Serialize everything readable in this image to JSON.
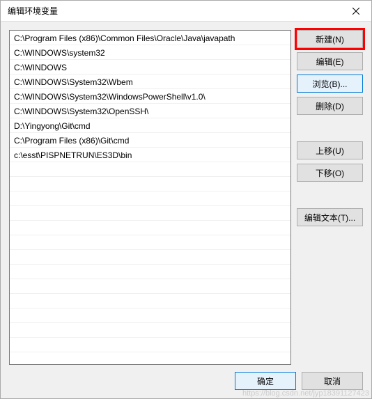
{
  "titlebar": {
    "title": "编辑环境变量"
  },
  "list": {
    "items": [
      "C:\\Program Files (x86)\\Common Files\\Oracle\\Java\\javapath",
      "C:\\WINDOWS\\system32",
      "C:\\WINDOWS",
      "C:\\WINDOWS\\System32\\Wbem",
      "C:\\WINDOWS\\System32\\WindowsPowerShell\\v1.0\\",
      "C:\\WINDOWS\\System32\\OpenSSH\\",
      "D:\\Yingyong\\Git\\cmd",
      "C:\\Program Files (x86)\\Git\\cmd",
      "c:\\esst\\PISPNETRUN\\ES3D\\bin"
    ]
  },
  "buttons": {
    "new": "新建(N)",
    "edit": "编辑(E)",
    "browse": "浏览(B)...",
    "delete": "删除(D)",
    "moveup": "上移(U)",
    "movedown": "下移(O)",
    "edittext": "编辑文本(T)...",
    "ok": "确定",
    "cancel": "取消"
  },
  "watermark": "https://blog.csdn.net/jyp18391127423"
}
